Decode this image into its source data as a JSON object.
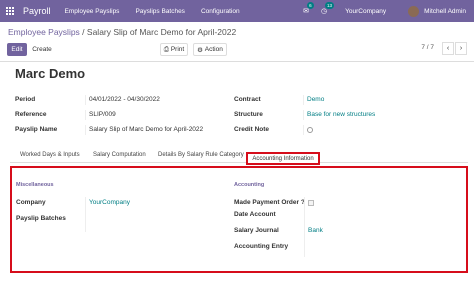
{
  "navbar": {
    "app_name": "Payroll",
    "menu": [
      "Employee Payslips",
      "Payslips Batches",
      "Configuration"
    ],
    "chat_count": "6",
    "activity_count": "13",
    "company": "YourCompany",
    "user": "Mitchell Admin",
    "accent": "#71639e",
    "badge_color": "#017e84"
  },
  "breadcrumb": {
    "parent": "Employee Payslips",
    "current": "Salary Slip of Marc Demo for April-2022"
  },
  "buttons": {
    "edit": "Edit",
    "create": "Create",
    "print": "Print",
    "action": "Action"
  },
  "pager": {
    "text": "7 / 7"
  },
  "form": {
    "name": "Marc Demo",
    "left_fields": [
      {
        "label": "Period",
        "value": "04/01/2022 - 04/30/2022"
      },
      {
        "label": "Reference",
        "value": "SLIP/009"
      },
      {
        "label": "Payslip Name",
        "value": "Salary Slip of Marc Demo for April-2022"
      }
    ],
    "right_fields": {
      "contract_label": "Contract",
      "contract": "Demo",
      "structure_label": "Structure",
      "structure": "Base for new structures",
      "credit_label": "Credit Note"
    }
  },
  "tabs": [
    "Worked Days & Inputs",
    "Salary Computation",
    "Details By Salary Rule Category",
    "Accounting Information"
  ],
  "accounting": {
    "misc_title": "Miscellaneous",
    "company_label": "Company",
    "company": "YourCompany",
    "batches_label": "Payslip Batches",
    "acc_title": "Accounting",
    "payment_order_label": "Made Payment Order ?",
    "date_account_label": "Date Account",
    "journal_label": "Salary Journal",
    "journal": "Bank",
    "entry_label": "Accounting Entry",
    "highlight_color": "#d60d1b"
  }
}
